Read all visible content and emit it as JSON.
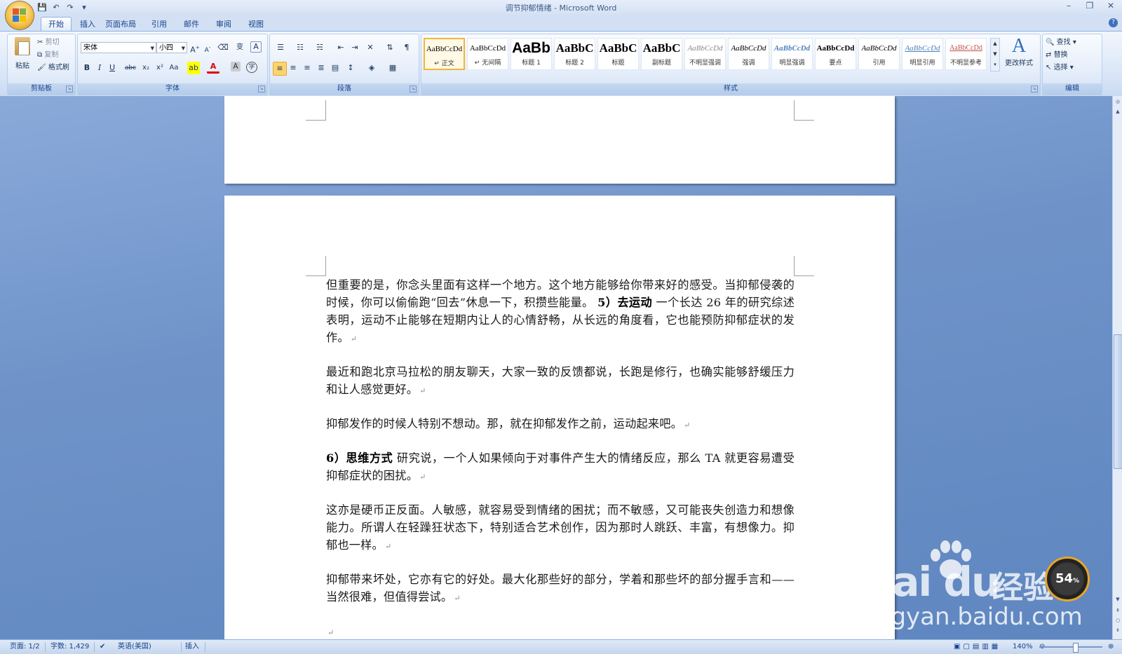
{
  "window": {
    "title": "调节抑郁情绪 - Microsoft Word",
    "minimize": "–",
    "restore": "❐",
    "close": "✕"
  },
  "qat": [
    "💾",
    "↶",
    "↷",
    "▾"
  ],
  "tabs": [
    {
      "label": "开始",
      "active": true
    },
    {
      "label": "插入"
    },
    {
      "label": "页面布局"
    },
    {
      "label": "引用"
    },
    {
      "label": "邮件"
    },
    {
      "label": "审阅"
    },
    {
      "label": "视图"
    }
  ],
  "ribbon": {
    "clipboard": {
      "label": "剪贴板",
      "paste": "粘贴",
      "cut": "剪切",
      "copy": "复制",
      "format_painter": "格式刷"
    },
    "font": {
      "label": "字体",
      "font_name": "宋体",
      "font_size": "小四"
    },
    "paragraph": {
      "label": "段落"
    },
    "styles": {
      "label": "样式",
      "items": [
        {
          "sample": "AaBbCcDd",
          "name": "↵ 正文",
          "active": true
        },
        {
          "sample": "AaBbCcDd",
          "name": "↵ 无间隔"
        },
        {
          "sample": "AaBb",
          "name": "标题 1"
        },
        {
          "sample": "AaBbC",
          "name": "标题 2"
        },
        {
          "sample": "AaBbC",
          "name": "标题"
        },
        {
          "sample": "AaBbC",
          "name": "副标题"
        },
        {
          "sample": "AaBbCcDd",
          "name": "不明显强调"
        },
        {
          "sample": "AaBbCcDd",
          "name": "强调"
        },
        {
          "sample": "AaBbCcDd",
          "name": "明显强调"
        },
        {
          "sample": "AaBbCcDd",
          "name": "要点"
        },
        {
          "sample": "AaBbCcDd",
          "name": "引用"
        },
        {
          "sample": "AaBbCcDd",
          "name": "明显引用"
        },
        {
          "sample": "AaBbCcDd",
          "name": "不明显参考"
        }
      ],
      "change_styles": "更改样式"
    },
    "editing": {
      "label": "编辑",
      "find": "查找",
      "replace": "替换",
      "select": "选择"
    }
  },
  "document": {
    "p1a": "但重要的是，你念头里面有这样一个地方。这个地方能够给你带来好的感受。当抑郁侵袭的时候，你可以偷偷跑“回去”休息一下，积攒些能量。 ",
    "p1b": "5）去运动",
    "p1c": " 一个长达 26 年的研究综述表明，运动不止能够在短期内让人的心情舒畅，从长远的角度看，它也能预防抑郁症状的发作。",
    "p2": "最近和跑北京马拉松的朋友聊天，大家一致的反馈都说，长跑是修行，也确实能够舒缓压力和让人感觉更好。",
    "p3": "抑郁发作的时候人特别不想动。那，就在抑郁发作之前，运动起来吧。",
    "p4a": "6）思维方式",
    "p4b": " 研究说，一个人如果倾向于对事件产生大的情绪反应，那么 TA 就更容易遭受抑郁症状的困扰。",
    "p5": "这亦是硬币正反面。人敏感，就容易受到情绪的困扰；而不敏感，又可能丧失创造力和想像能力。所谓人在轻躁狂状态下，特别适合艺术创作，因为那时人跳跃、丰富，有想像力。抑郁也一样。",
    "p6": "抑郁带来坏处，它亦有它的好处。最大化那些好的部分，学着和那些坏的部分握手言和——当然很难，但值得尝试。",
    "pmark": "↵"
  },
  "statusbar": {
    "page": "页面: 1/2",
    "words": "字数: 1,429",
    "language": "英语(美国)",
    "mode": "插入",
    "zoom": "140%"
  },
  "watermark": {
    "logo": "Bai  du",
    "cn": "经验",
    "url": "jingyan.baidu.com",
    "badge": "54",
    "badge_unit": "%"
  }
}
